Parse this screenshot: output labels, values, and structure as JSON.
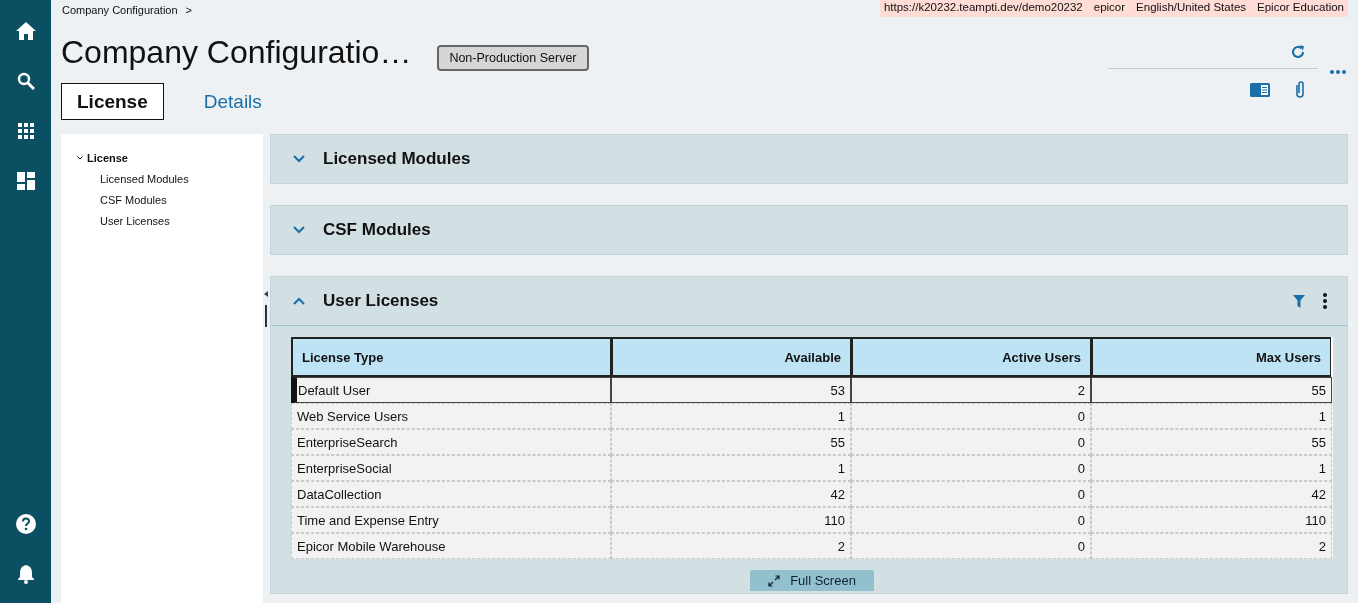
{
  "nav": {
    "top_items": [
      {
        "kind": "home"
      },
      {
        "kind": "search"
      },
      {
        "kind": "apps"
      },
      {
        "kind": "dashboard"
      }
    ],
    "bottom_items": [
      {
        "kind": "help"
      },
      {
        "kind": "bell"
      }
    ]
  },
  "breadcrumb": [
    "Company Configuration",
    ">"
  ],
  "environment": [
    "https://k20232.teampti.dev/demo20232",
    "epicor",
    "English/United States",
    "Epicor Education"
  ],
  "title": "Company Configuratio…",
  "server_badge": "Non-Production Server",
  "tabs": [
    {
      "label": "License",
      "selected": true
    },
    {
      "label": "Details",
      "selected": false
    }
  ],
  "tree": [
    {
      "label": "License",
      "expanded": true,
      "children": [
        {
          "label": "Licensed Modules"
        },
        {
          "label": "CSF Modules"
        },
        {
          "label": "User Licenses"
        }
      ]
    }
  ],
  "sections": [
    {
      "title": "Licensed Modules",
      "expanded": false
    },
    {
      "title": "CSF Modules",
      "expanded": false
    },
    {
      "title": "User Licenses",
      "expanded": true,
      "table": {
        "columns": [
          "License Type",
          "Available",
          "Active Users",
          "Max Users"
        ],
        "rows": [
          {
            "cells": [
              "Default User",
              "53",
              "2",
              "55"
            ],
            "selected": true
          },
          {
            "cells": [
              "Web Service Users",
              "1",
              "0",
              "1"
            ],
            "selected": false
          },
          {
            "cells": [
              "EnterpriseSearch",
              "55",
              "0",
              "55"
            ],
            "selected": false
          },
          {
            "cells": [
              "EnterpriseSocial",
              "1",
              "0",
              "1"
            ],
            "selected": false
          },
          {
            "cells": [
              "DataCollection",
              "42",
              "0",
              "42"
            ],
            "selected": false
          },
          {
            "cells": [
              "Time and Expense Entry",
              "110",
              "0",
              "110"
            ],
            "selected": false
          },
          {
            "cells": [
              "Epicor Mobile Warehouse",
              "2",
              "0",
              "2"
            ],
            "selected": false
          }
        ]
      },
      "full_screen": "Full Screen"
    }
  ]
}
